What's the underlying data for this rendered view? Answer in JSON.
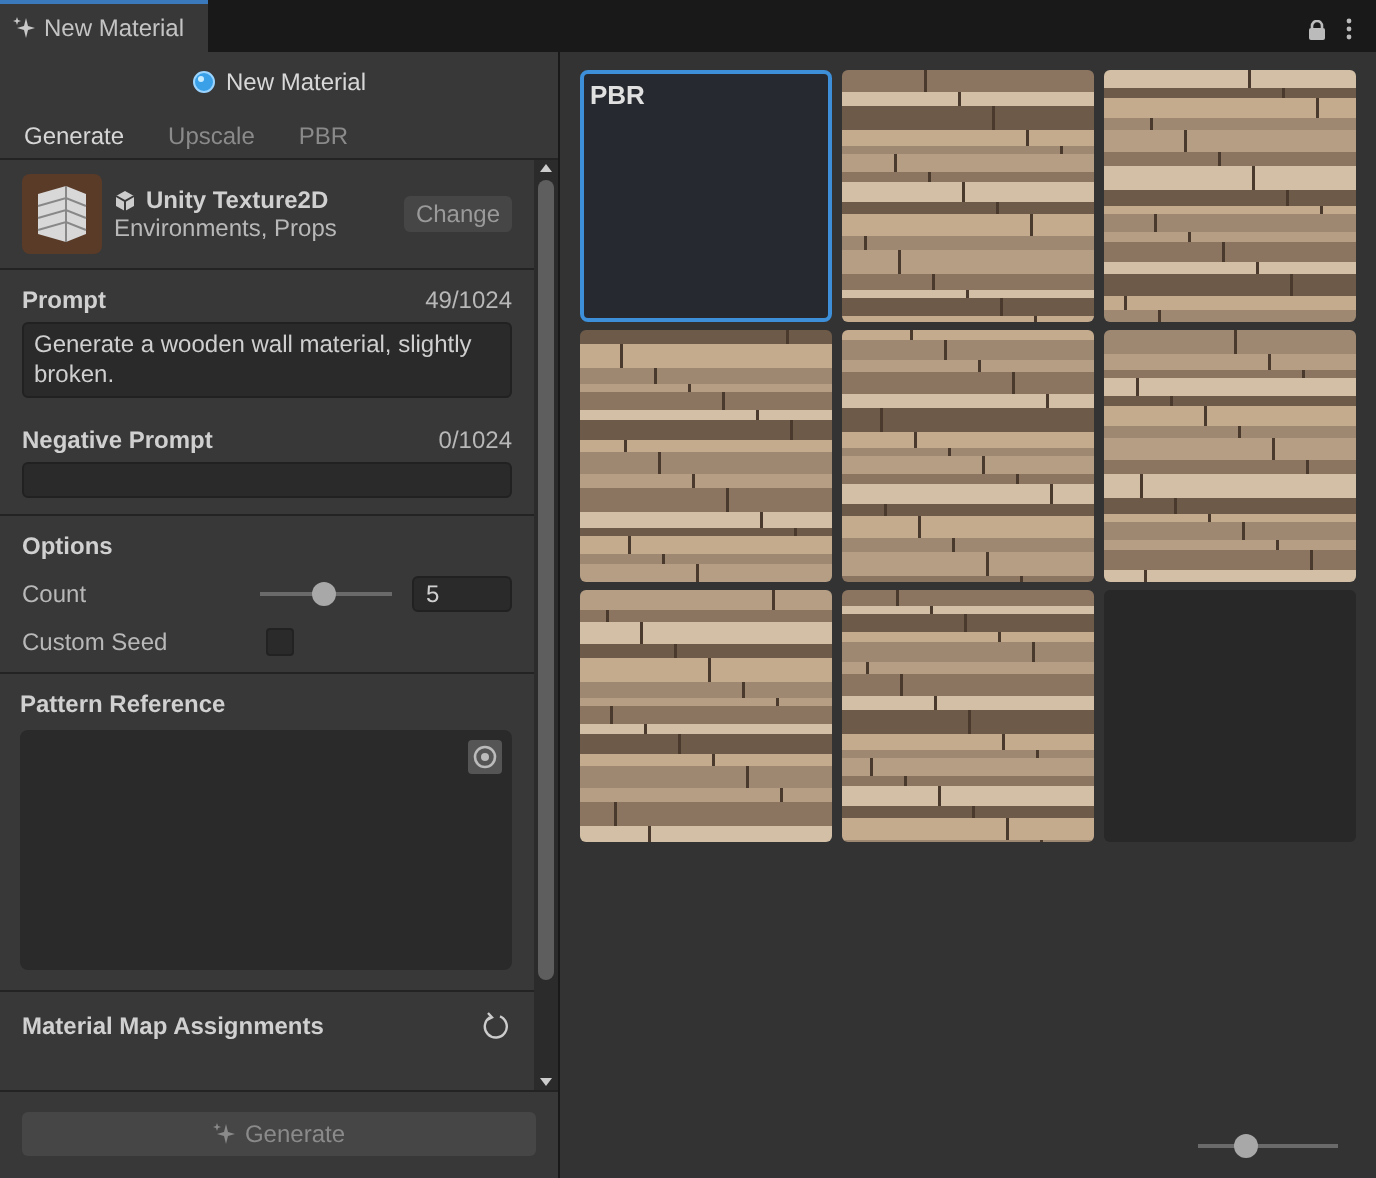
{
  "window": {
    "tab_title": "New Material"
  },
  "header": {
    "title": "New Material"
  },
  "tabs": [
    {
      "label": "Generate",
      "selected": true
    },
    {
      "label": "Upscale",
      "selected": false
    },
    {
      "label": "PBR",
      "selected": false
    }
  ],
  "model": {
    "name": "Unity Texture2D",
    "tags": "Environments, Props",
    "button": "Change"
  },
  "prompt": {
    "label": "Prompt",
    "count": "49/1024",
    "value": "Generate a wooden wall material, slightly broken."
  },
  "negative_prompt": {
    "label": "Negative Prompt",
    "count": "0/1024"
  },
  "options": {
    "title": "Options",
    "count_label": "Count",
    "count_slider": {
      "level": 0.49
    },
    "count_value": "5",
    "seed_label": "Custom Seed",
    "seed_checked": false
  },
  "pattern_reference": {
    "title": "Pattern Reference"
  },
  "material_map": {
    "title": "Material Map Assignments"
  },
  "generate_button": "Generate",
  "tiles": [
    {
      "kind": "pbr",
      "label": "PBR",
      "selected": true
    },
    {
      "kind": "texture",
      "selected": false
    },
    {
      "kind": "texture",
      "selected": false
    },
    {
      "kind": "texture",
      "selected": false
    },
    {
      "kind": "texture",
      "selected": false
    },
    {
      "kind": "texture",
      "selected": false
    },
    {
      "kind": "texture",
      "selected": false
    },
    {
      "kind": "texture",
      "selected": false
    },
    {
      "kind": "empty",
      "selected": false
    }
  ],
  "zoom_slider": {
    "level": 0.34
  }
}
